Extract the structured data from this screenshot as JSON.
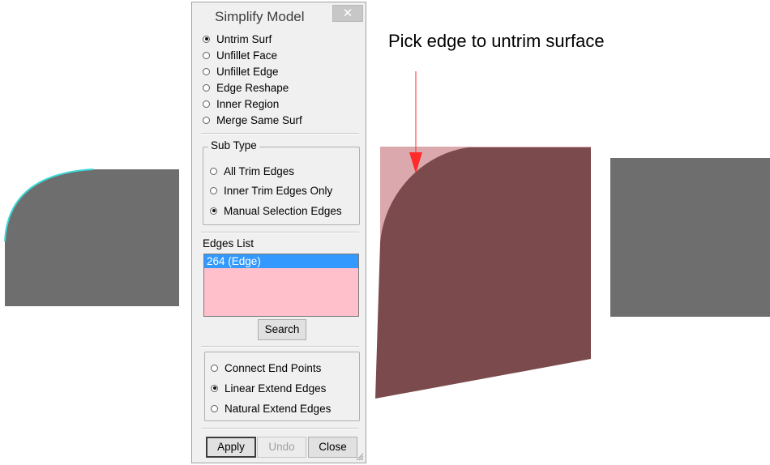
{
  "dialog": {
    "title": "Simplify Model",
    "close_glyph": "✕",
    "modes": [
      {
        "label": "Untrim Surf",
        "checked": true
      },
      {
        "label": "Unfillet Face",
        "checked": false
      },
      {
        "label": "Unfillet Edge",
        "checked": false
      },
      {
        "label": "Edge Reshape",
        "checked": false
      },
      {
        "label": "Inner Region",
        "checked": false
      },
      {
        "label": "Merge Same Surf",
        "checked": false
      }
    ],
    "sub_type": {
      "legend": "Sub Type",
      "options": [
        {
          "label": "All Trim Edges",
          "checked": false
        },
        {
          "label": "Inner Trim Edges Only",
          "checked": false
        },
        {
          "label": "Manual Selection Edges",
          "checked": true
        }
      ]
    },
    "edges_list": {
      "label": "Edges List",
      "items": [
        "264 (Edge)"
      ],
      "selected_index": 0,
      "background": "#ffc0cb",
      "selection_color": "#3399ff"
    },
    "search_label": "Search",
    "extend_options": [
      {
        "label": "Connect End Points",
        "checked": false
      },
      {
        "label": "Linear Extend Edges",
        "checked": true
      },
      {
        "label": "Natural Extend Edges",
        "checked": false
      }
    ],
    "buttons": {
      "apply": "Apply",
      "undo": "Undo",
      "close": "Close"
    }
  },
  "viewport": {
    "instruction": "Pick edge to untrim surface",
    "colors": {
      "gray_surface": "#6e6e6e",
      "trimmed_surface": "#7a4a4d",
      "untrimmed_region": "#dba9ad",
      "pick_arrow": "#ff2a2a",
      "highlight_edge": "#3fd8d8"
    },
    "icons": [
      "gray-surface-left",
      "trimmed-surface",
      "gray-surface-right",
      "pick-arrow"
    ]
  }
}
